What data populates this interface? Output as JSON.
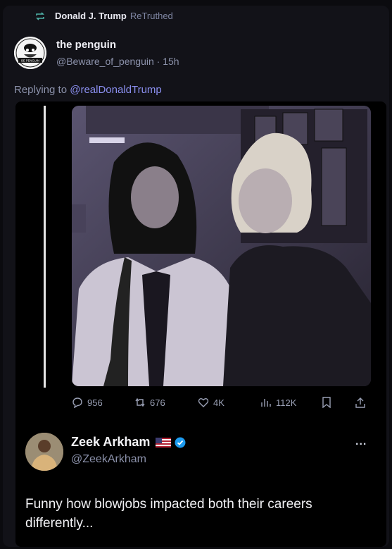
{
  "retruth": {
    "name": "Donald J. Trump",
    "action": "ReTruthed"
  },
  "post": {
    "display_name": "the penguin",
    "handle": "@Beware_of_penguin",
    "time": "· 15h",
    "replying_prefix": "Replying to",
    "replying_to": "@realDonaldTrump",
    "avatar_text": "BE PENGUIN"
  },
  "embedded": {
    "photo_icon": "photo-of-two-women",
    "stats": {
      "replies": "956",
      "retweets": "676",
      "likes": "4K",
      "views": "112K"
    },
    "quoted": {
      "display_name": "Zeek Arkham",
      "handle": "@ZeekArkham",
      "text": "Funny how blowjobs impacted both their careers differently...",
      "more": "..."
    }
  },
  "colors": {
    "link": "#8b8ff0",
    "muted": "#8c92ab",
    "verified": "#1d9bf0",
    "background": "#121218"
  }
}
